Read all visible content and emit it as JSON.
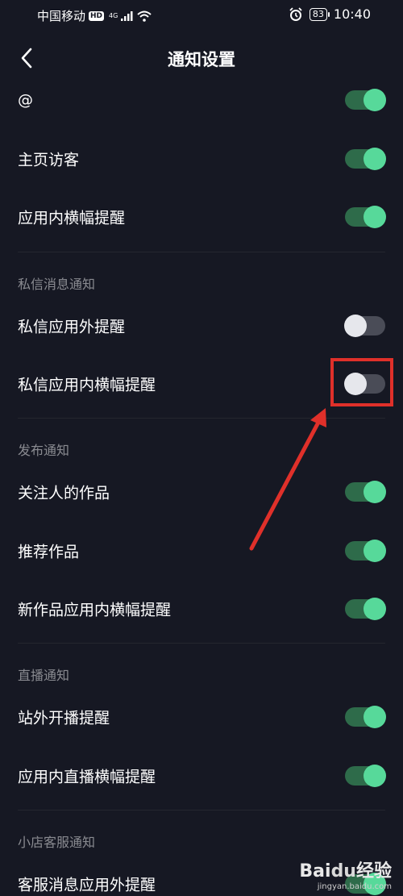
{
  "status_bar": {
    "carrier": "中国移动",
    "hd_badge": "HD",
    "network": "4G",
    "battery": "83",
    "time": "10:40"
  },
  "header": {
    "title": "通知设置"
  },
  "rows_top": [
    {
      "label": "@",
      "state": "on"
    },
    {
      "label": "主页访客",
      "state": "on"
    },
    {
      "label": "应用内横幅提醒",
      "state": "on"
    }
  ],
  "sections": [
    {
      "title": "私信消息通知",
      "items": [
        {
          "label": "私信应用外提醒",
          "state": "off"
        },
        {
          "label": "私信应用内横幅提醒",
          "state": "off"
        }
      ]
    },
    {
      "title": "发布通知",
      "items": [
        {
          "label": "关注人的作品",
          "state": "on"
        },
        {
          "label": "推荐作品",
          "state": "on"
        },
        {
          "label": "新作品应用内横幅提醒",
          "state": "on"
        }
      ]
    },
    {
      "title": "直播通知",
      "items": [
        {
          "label": "站外开播提醒",
          "state": "on"
        },
        {
          "label": "应用内直播横幅提醒",
          "state": "on"
        }
      ]
    },
    {
      "title": "小店客服通知",
      "items": [
        {
          "label": "客服消息应用外提醒",
          "state": "on"
        }
      ]
    }
  ],
  "annotation": {
    "color": "#e0302a"
  },
  "watermark": {
    "logo_bai": "Bai",
    "logo_du": "du",
    "logo_suffix": "经验",
    "url": "jingyan.baidu.com"
  },
  "colors": {
    "background": "#161823",
    "toggle_on": "#57d99a",
    "toggle_off": "#e6e7ec",
    "section_title": "#8a8b91"
  }
}
